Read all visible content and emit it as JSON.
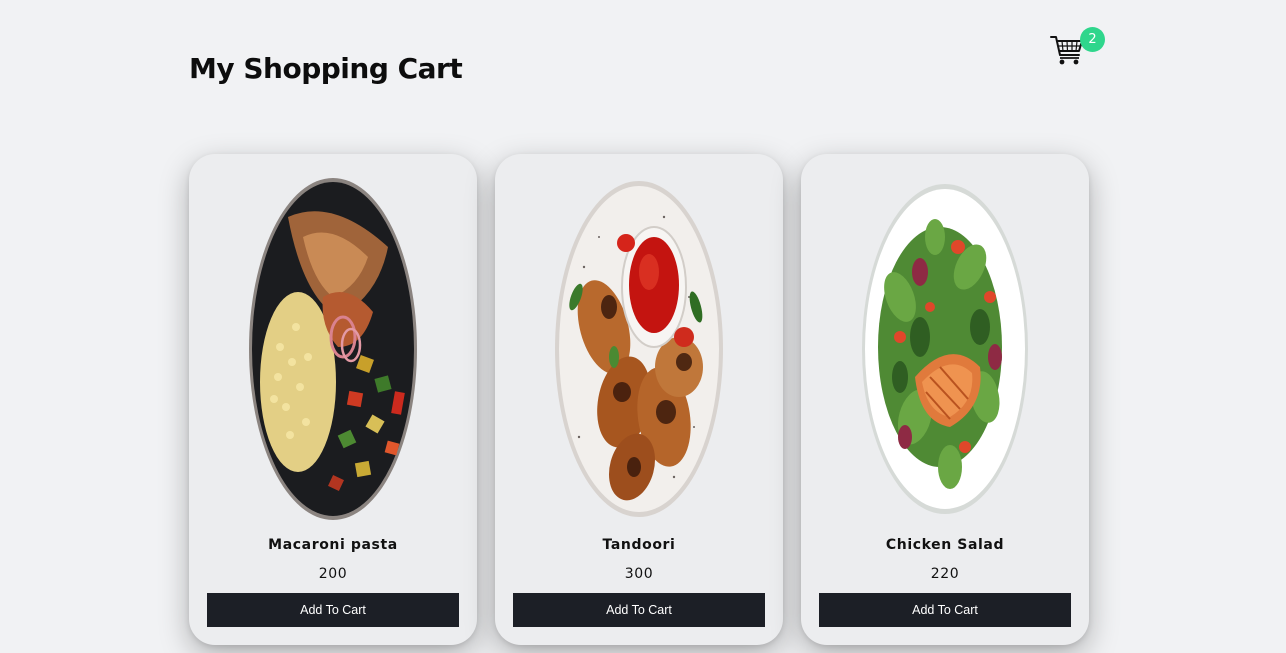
{
  "header": {
    "title": "My Shopping Cart",
    "cart_icon": "shopping-cart-icon",
    "cart_count": "2"
  },
  "products": [
    {
      "name": "Macaroni pasta",
      "price": "200",
      "button_label": "Add To Cart"
    },
    {
      "name": "Tandoori",
      "price": "300",
      "button_label": "Add To Cart"
    },
    {
      "name": "Chicken Salad",
      "price": "220",
      "button_label": "Add To Cart"
    }
  ],
  "colors": {
    "background": "#f1f2f4",
    "card": "#ecedef",
    "button": "#1c1f26",
    "badge": "#2fd68c"
  }
}
